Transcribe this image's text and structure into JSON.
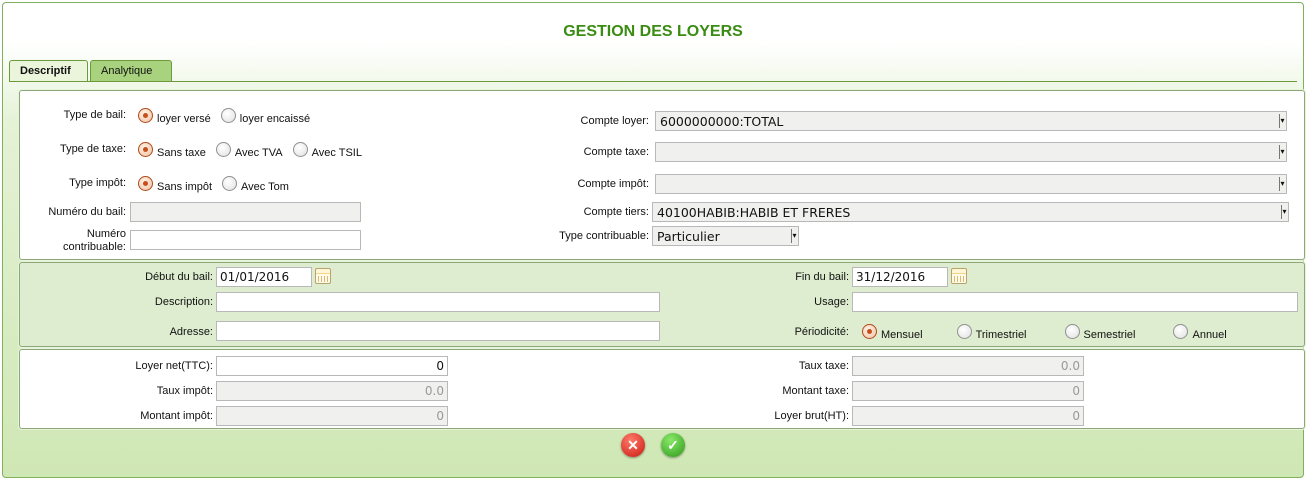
{
  "title": "GESTION DES LOYERS",
  "tabs": [
    {
      "label": "Descriptif",
      "active": true
    },
    {
      "label": "Analytique",
      "active": false
    }
  ],
  "section1": {
    "type_bail": {
      "label": "Type de bail:",
      "options": [
        "loyer versé",
        "loyer encaissé"
      ],
      "selected": 0
    },
    "type_taxe": {
      "label": "Type de taxe:",
      "options": [
        "Sans taxe",
        "Avec TVA",
        "Avec TSIL"
      ],
      "selected": 0
    },
    "type_impot": {
      "label": "Type impôt:",
      "options": [
        "Sans impôt",
        "Avec Tom"
      ],
      "selected": 0
    },
    "numero_bail": {
      "label": "Numéro du bail:",
      "value": ""
    },
    "numero_contribuable": {
      "label_line1": "Numéro",
      "label_line2": "contribuable:",
      "value": ""
    },
    "compte_loyer": {
      "label": "Compte loyer:",
      "value": "6000000000:TOTAL"
    },
    "compte_taxe": {
      "label": "Compte taxe:",
      "value": ""
    },
    "compte_impot": {
      "label": "Compte impôt:",
      "value": ""
    },
    "compte_tiers": {
      "label": "Compte tiers:",
      "value": "40100HABIB:HABIB ET FRERES"
    },
    "type_contribuable": {
      "label": "Type contribuable:",
      "value": "Particulier"
    }
  },
  "section2": {
    "debut_bail": {
      "label": "Début du bail:",
      "value": "01/01/2016"
    },
    "fin_bail": {
      "label": "Fin du bail:",
      "value": "31/12/2016"
    },
    "description": {
      "label": "Description:",
      "value": ""
    },
    "usage": {
      "label": "Usage:",
      "value": ""
    },
    "adresse": {
      "label": "Adresse:",
      "value": ""
    },
    "periodicite": {
      "label": "Périodicité:",
      "options": [
        "Mensuel",
        "Trimestriel",
        "Semestriel",
        "Annuel"
      ],
      "selected": 0
    }
  },
  "section3": {
    "loyer_net": {
      "label": "Loyer net(TTC):",
      "value": "0"
    },
    "taux_impot": {
      "label": "Taux impôt:",
      "value": "0.0"
    },
    "montant_impot": {
      "label": "Montant impôt:",
      "value": "0"
    },
    "taux_taxe": {
      "label": "Taux taxe:",
      "value": "0.0"
    },
    "montant_taxe": {
      "label": "Montant taxe:",
      "value": "0"
    },
    "loyer_brut": {
      "label": "Loyer brut(HT):",
      "value": "0"
    }
  },
  "buttons": {
    "cancel_icon": "cancel-icon",
    "confirm_icon": "check-icon"
  },
  "colors": {
    "title": "#3a8c12",
    "accent_green": "#cfe7b4",
    "radio_selected": "#c6501c"
  }
}
